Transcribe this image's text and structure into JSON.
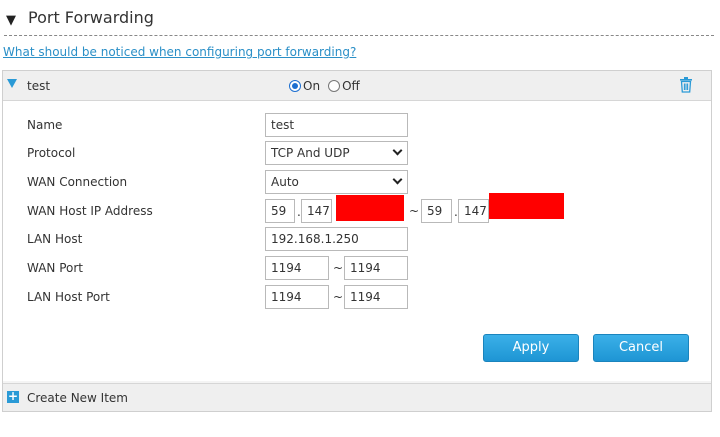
{
  "section": {
    "title": "Port Forwarding"
  },
  "help_link": "What should be noticed when configuring port forwarding?",
  "item": {
    "name": "test",
    "status_on_label": "On",
    "status_off_label": "Off",
    "status": "On"
  },
  "form": {
    "name_label": "Name",
    "name_value": "test",
    "protocol_label": "Protocol",
    "protocol_value": "TCP And UDP",
    "wan_connection_label": "WAN Connection",
    "wan_connection_value": "Auto",
    "wan_host_ip_label": "WAN Host IP Address",
    "wan_ip_start_1": "59",
    "wan_ip_start_2": "147",
    "wan_ip_end_1": "59",
    "wan_ip_end_2": "147",
    "lan_host_label": "LAN Host",
    "lan_host_value": "192.168.1.250",
    "wan_port_label": "WAN Port",
    "wan_port_start": "1194",
    "wan_port_end": "1194",
    "lan_port_label": "LAN Host Port",
    "lan_port_start": "1194",
    "lan_port_end": "1194",
    "range_separator": "~",
    "ip_separator": "."
  },
  "buttons": {
    "apply": "Apply",
    "cancel": "Cancel"
  },
  "create_item": "Create New Item",
  "colors": {
    "accent": "#2a9ad6",
    "redaction": "#ff0000"
  }
}
